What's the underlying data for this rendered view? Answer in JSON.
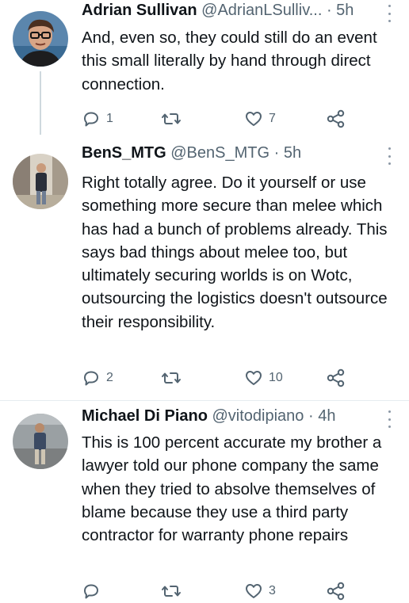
{
  "tweets": [
    {
      "name": "Adrian Sullivan",
      "handle": "@AdrianLSulliv...",
      "time": "· 5h",
      "text": "And, even so, they could still do an event this small literally by hand through direct connection.",
      "replies": "1",
      "retweets": "",
      "likes": "7"
    },
    {
      "name": "BenS_MTG",
      "handle": "@BenS_MTG",
      "time": "· 5h",
      "text": "Right totally agree. Do it yourself or use something more secure than melee which has had a bunch of problems already. This says bad things about melee too, but ultimately securing worlds is on Wotc, outsourcing the logistics doesn't outsource their responsibility.",
      "replies": "2",
      "retweets": "",
      "likes": "10"
    },
    {
      "name": "Michael Di Piano",
      "handle": "@vitodipiano",
      "time": "· 4h",
      "text": "This is 100 percent accurate my brother a lawyer told our phone company the same when they tried to absolve themselves of blame because they use a third party contractor for warranty phone repairs",
      "replies": "",
      "retweets": "",
      "likes": "3"
    }
  ],
  "icons": {
    "reply": "reply-icon",
    "retweet": "retweet-icon",
    "like": "heart-icon",
    "share": "share-icon",
    "more": "more-icon"
  },
  "colors": {
    "text": "#0f1419",
    "secondary": "#536471",
    "thread_line": "#cfd9de"
  }
}
